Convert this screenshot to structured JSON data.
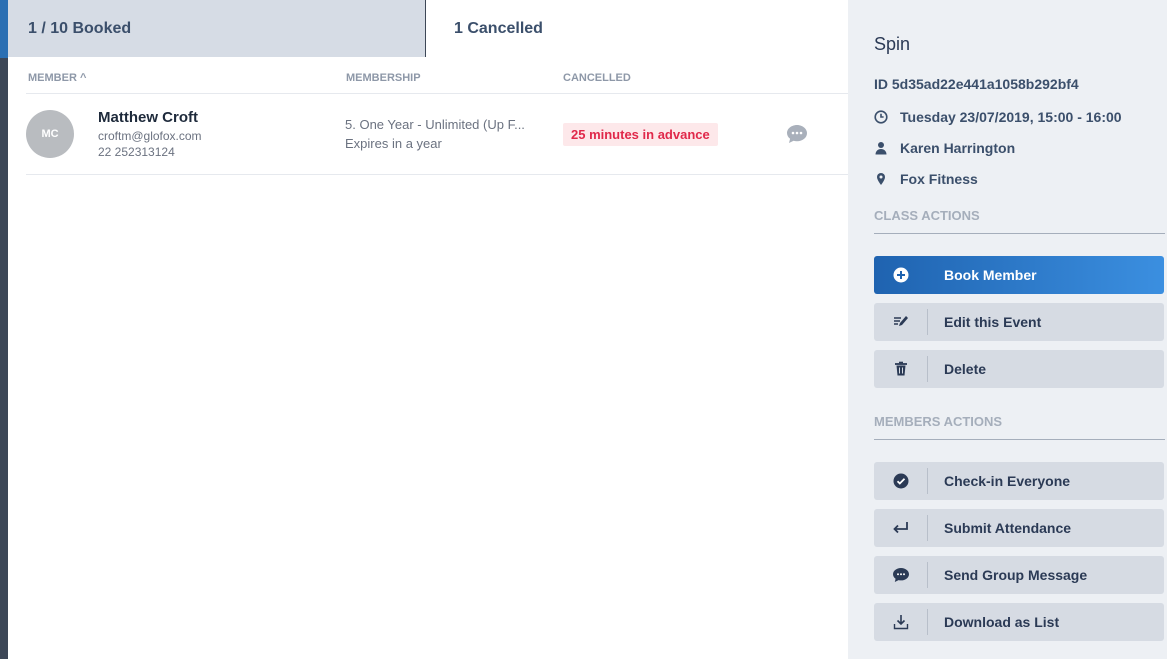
{
  "tabs": {
    "booked": "1 / 10 Booked",
    "cancelled": "1 Cancelled"
  },
  "table": {
    "headers": {
      "member": "MEMBER ^",
      "membership": "MEMBERSHIP",
      "cancelled": "CANCELLED"
    },
    "rows": [
      {
        "initials": "MC",
        "name": "Matthew Croft",
        "email": "croftm@glofox.com",
        "phone": "22 252313124",
        "membership": "5. One Year - Unlimited (Up F...",
        "expires": "Expires in a year",
        "cancelled": "25 minutes in advance"
      }
    ]
  },
  "event": {
    "title": "Spin",
    "id": "ID 5d35ad22e441a1058b292bf4",
    "datetime": "Tuesday 23/07/2019, 15:00 - 16:00",
    "trainer": "Karen Harrington",
    "location": "Fox Fitness"
  },
  "class_actions": {
    "label": "CLASS ACTIONS",
    "book": "Book Member",
    "edit": "Edit this Event",
    "delete": "Delete"
  },
  "member_actions": {
    "label": "MEMBERS ACTIONS",
    "checkin": "Check-in Everyone",
    "submit": "Submit Attendance",
    "message": "Send Group Message",
    "download": "Download as List"
  },
  "colors": {
    "accent": "#1f63b0",
    "cancel_text": "#e0284a",
    "cancel_bg": "#fde8ea",
    "panel": "#edf0f4"
  },
  "icons": [
    "comment-icon",
    "clock-icon",
    "user-icon",
    "map-pin-icon",
    "plus-circle-icon",
    "edit-icon",
    "trash-icon",
    "check-circle-icon",
    "return-icon",
    "message-icon",
    "download-icon"
  ]
}
